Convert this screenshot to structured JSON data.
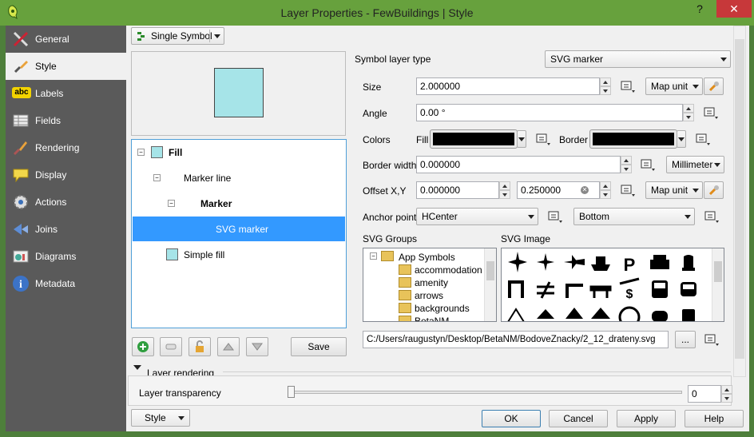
{
  "window": {
    "title": "Layer Properties - FewBuildings | Style",
    "help_label": "?",
    "close_label": "✕"
  },
  "sidebar": {
    "items": [
      {
        "label": "General",
        "icon": "general-icon"
      },
      {
        "label": "Style",
        "icon": "style-icon"
      },
      {
        "label": "Labels",
        "icon": "labels-icon"
      },
      {
        "label": "Fields",
        "icon": "fields-icon"
      },
      {
        "label": "Rendering",
        "icon": "rendering-icon"
      },
      {
        "label": "Display",
        "icon": "display-icon"
      },
      {
        "label": "Actions",
        "icon": "actions-icon"
      },
      {
        "label": "Joins",
        "icon": "joins-icon"
      },
      {
        "label": "Diagrams",
        "icon": "diagrams-icon"
      },
      {
        "label": "Metadata",
        "icon": "metadata-icon"
      }
    ],
    "selected": "Style",
    "labels_badge": "abc"
  },
  "renderer": {
    "value": "Single Symbol"
  },
  "tree": {
    "rows": [
      {
        "label": "Fill"
      },
      {
        "label": "Marker line"
      },
      {
        "label": "Marker"
      },
      {
        "label": "SVG marker"
      },
      {
        "label": "Simple fill"
      }
    ]
  },
  "symbol": {
    "fill_color": "#a6e4e8"
  },
  "tree_buttons": {
    "save": "Save"
  },
  "props": {
    "layer_type_label": "Symbol layer type",
    "layer_type": "SVG marker",
    "size_label": "Size",
    "size": "2.000000",
    "size_unit": "Map unit",
    "angle_label": "Angle",
    "angle": "0.00 °",
    "colors_label": "Colors",
    "fill_label": "Fill",
    "border_label": "Border",
    "fill_color": "#000000",
    "border_color": "#000000",
    "border_width_label": "Border width",
    "border_width": "0.000000",
    "border_width_unit": "Millimeter",
    "offset_label": "Offset X,Y",
    "offset_x": "0.000000",
    "offset_y": "0.250000",
    "offset_unit": "Map unit",
    "anchor_label": "Anchor point",
    "anchor_h": "HCenter",
    "anchor_v": "Bottom",
    "svg_groups_label": "SVG Groups",
    "svg_image_label": "SVG Image",
    "groups": [
      "App Symbols",
      "accommodation",
      "amenity",
      "arrows",
      "backgrounds",
      "BetaNM"
    ],
    "svg_path": "C:/Users/raugustyn/Desktop/BetaNM/BodoveZnacky/2_12_drateny.svg",
    "browse_label": "..."
  },
  "layer_rendering": {
    "section_label": "Layer rendering",
    "transparency_label": "Layer transparency",
    "transparency": "0"
  },
  "footer": {
    "style": "Style",
    "ok": "OK",
    "cancel": "Cancel",
    "apply": "Apply",
    "help": "Help"
  }
}
